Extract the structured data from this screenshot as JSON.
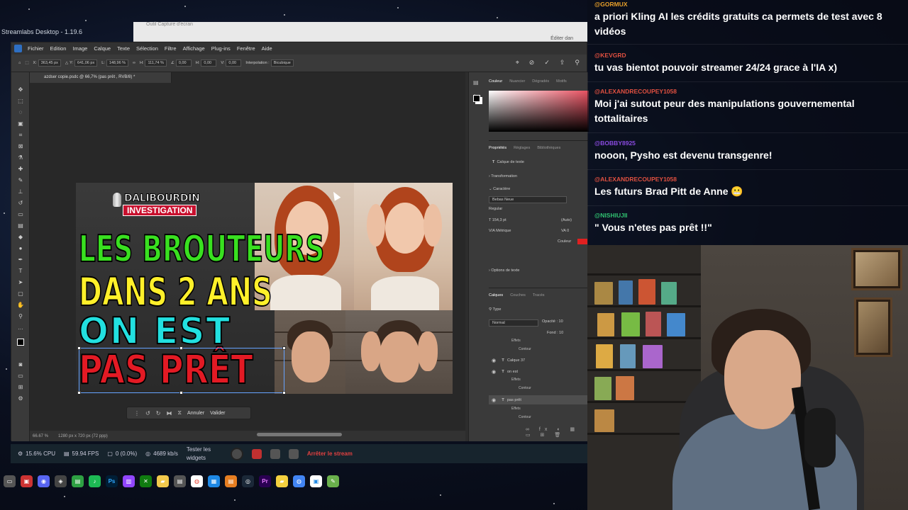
{
  "streamlabs": {
    "title": "Streamlabs Desktop - 1.19.6",
    "cpu": "15.6% CPU",
    "fps": "59.94 FPS",
    "dropped": "0 (0.0%)",
    "bitrate": "4689 kb/s",
    "test_widgets": "Tester les widgets",
    "stop_stream": "Arrêter le stream"
  },
  "background_window": {
    "title": "Outil Capture d'écran",
    "right_text": "Éditer dan"
  },
  "photoshop": {
    "menu": [
      "Fichier",
      "Edition",
      "Image",
      "Calque",
      "Texte",
      "Sélection",
      "Filtre",
      "Affichage",
      "Plug-ins",
      "Fenêtre",
      "Aide"
    ],
    "options": {
      "x_label": "X:",
      "x_value": "363,45 px",
      "y_label": "Y:",
      "y_value": "641,06 px",
      "w_label": "L:",
      "w_value": "148,96 %",
      "h_label": "H:",
      "h_value": "111,74 %",
      "angle_value": "0,00",
      "hskew_label": "H:",
      "hskew_value": "0,00",
      "vskew_label": "V:",
      "vskew_value": "0,00",
      "interp_label": "Interpolation :",
      "interp_value": "Bicubique"
    },
    "doc_tab": "azdser copie.psdc @ 66,7% (pas prêt , RVB/8) *",
    "zoom": "66.67 %",
    "doc_size": "1280 px x 720 px (72 ppp)",
    "context_bar": {
      "cancel": "Annuler",
      "validate": "Valider"
    },
    "panels": {
      "color_tabs": [
        "Couleur",
        "Nuancier",
        "Dégradés",
        "Motifs"
      ],
      "prop_tabs": [
        "Propriétés",
        "Réglages",
        "Bibliothèques"
      ],
      "layer_type": "Calque de texte",
      "transformation": "Transformation",
      "character": "Caractère",
      "font_family": "Bebas Neue",
      "font_style": "Regular",
      "font_size": "154,3 pt",
      "leading": "(Auto)",
      "kerning": "Métrique",
      "tracking": "0",
      "color_label": "Couleur",
      "text_options": "Options de texte",
      "layer_tabs": [
        "Calques",
        "Couches",
        "Tracés"
      ],
      "search_placeholder": "Type",
      "blend_mode": "Normal",
      "opacity_label": "Opacité :",
      "opacity_value": "10",
      "fill_label": "Fond :",
      "fill_value": "10",
      "layers": [
        {
          "sub": [
            "Effets",
            "Contour"
          ]
        },
        {
          "name": "Calque 37",
          "type": "T"
        },
        {
          "name": "on est",
          "type": "T",
          "sub": [
            "Effets",
            "Contour"
          ]
        },
        {
          "name": "pas prêt",
          "type": "T",
          "sub": [
            "Effets",
            "Contour"
          ]
        }
      ]
    }
  },
  "thumbnail": {
    "logo_line1": "DALIBOURDIN",
    "logo_line2": "INVESTIGATION",
    "line1": "LES BROUTEURS",
    "line2": "DANS 2 ANS",
    "line3": "ON EST",
    "line4": "PAS PRÊT",
    "colors": {
      "line1": "#39e020",
      "line2": "#fff02a",
      "line3": "#22e0e0",
      "line4": "#e31a24"
    }
  },
  "chat": {
    "messages": [
      {
        "user": "@GORMUX",
        "user_color": "#e8a02a",
        "text": "a priori Kling AI les crédits gratuits ca permets de test avec 8 vidéos"
      },
      {
        "user": "@KEVGRD",
        "user_color": "#e05040",
        "text": "tu vas bientot pouvoir streamer 24/24 grace à l'IA x)"
      },
      {
        "user": "@ALEXANDRECOUPEY1058",
        "user_color": "#e05040",
        "text": "Moi j'ai sutout peur des manipulations gouvernemental tottalitaires"
      },
      {
        "user": "@BOBBY8925",
        "user_color": "#8a4ae0",
        "text": "nooon, Pysho est devenu transgenre!"
      },
      {
        "user": "@ALEXANDRECOUPEY1058",
        "user_color": "#e05040",
        "text": "Les futurs Brad Pitt de Anne 😬"
      },
      {
        "user": "@NISHIUJII",
        "user_color": "#30c070",
        "text": "\" Vous n'etes pas prêt !!\""
      }
    ]
  }
}
